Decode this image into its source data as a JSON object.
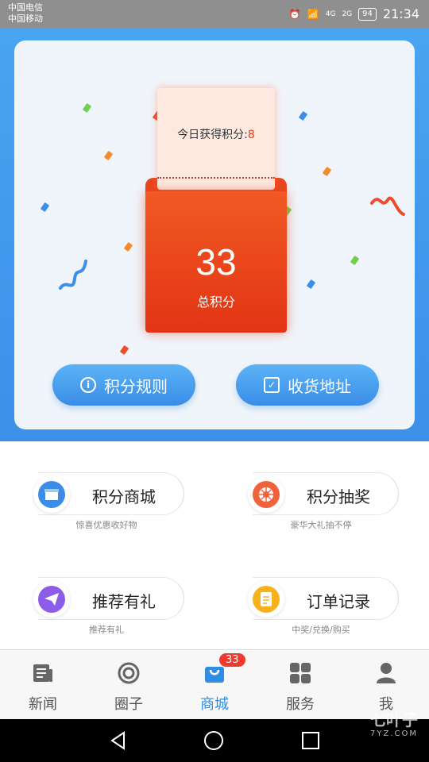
{
  "status_bar": {
    "carrier1": "中国电信",
    "carrier2": "中国移动",
    "net1": "4G",
    "net2": "2G",
    "battery": "94",
    "time": "21:34"
  },
  "points": {
    "today_label": "今日获得积分:",
    "today_value": "8",
    "total_value": "33",
    "total_label": "总积分"
  },
  "buttons": {
    "rules": "积分规则",
    "address": "收货地址"
  },
  "features": [
    {
      "title": "积分商城",
      "subtitle": "惊喜优惠收好物",
      "icon": "store-icon",
      "color": "#3c8de6"
    },
    {
      "title": "积分抽奖",
      "subtitle": "豪华大礼抽不停",
      "icon": "wheel-icon",
      "color": "#f0623c"
    },
    {
      "title": "推荐有礼",
      "subtitle": "推荐有礼",
      "icon": "paper-plane-icon",
      "color": "#8d5ce8"
    },
    {
      "title": "订单记录",
      "subtitle": "中奖/兑换/购买",
      "icon": "order-icon",
      "color": "#f7b21b"
    }
  ],
  "nav": [
    {
      "label": "新闻",
      "icon": "news-icon"
    },
    {
      "label": "圈子",
      "icon": "circle-icon"
    },
    {
      "label": "商城",
      "icon": "shop-bag-icon",
      "badge": "33"
    },
    {
      "label": "服务",
      "icon": "grid-icon"
    },
    {
      "label": "我",
      "icon": "person-icon"
    }
  ],
  "watermark": {
    "name": "七叶子",
    "site": "7YZ.COM"
  }
}
